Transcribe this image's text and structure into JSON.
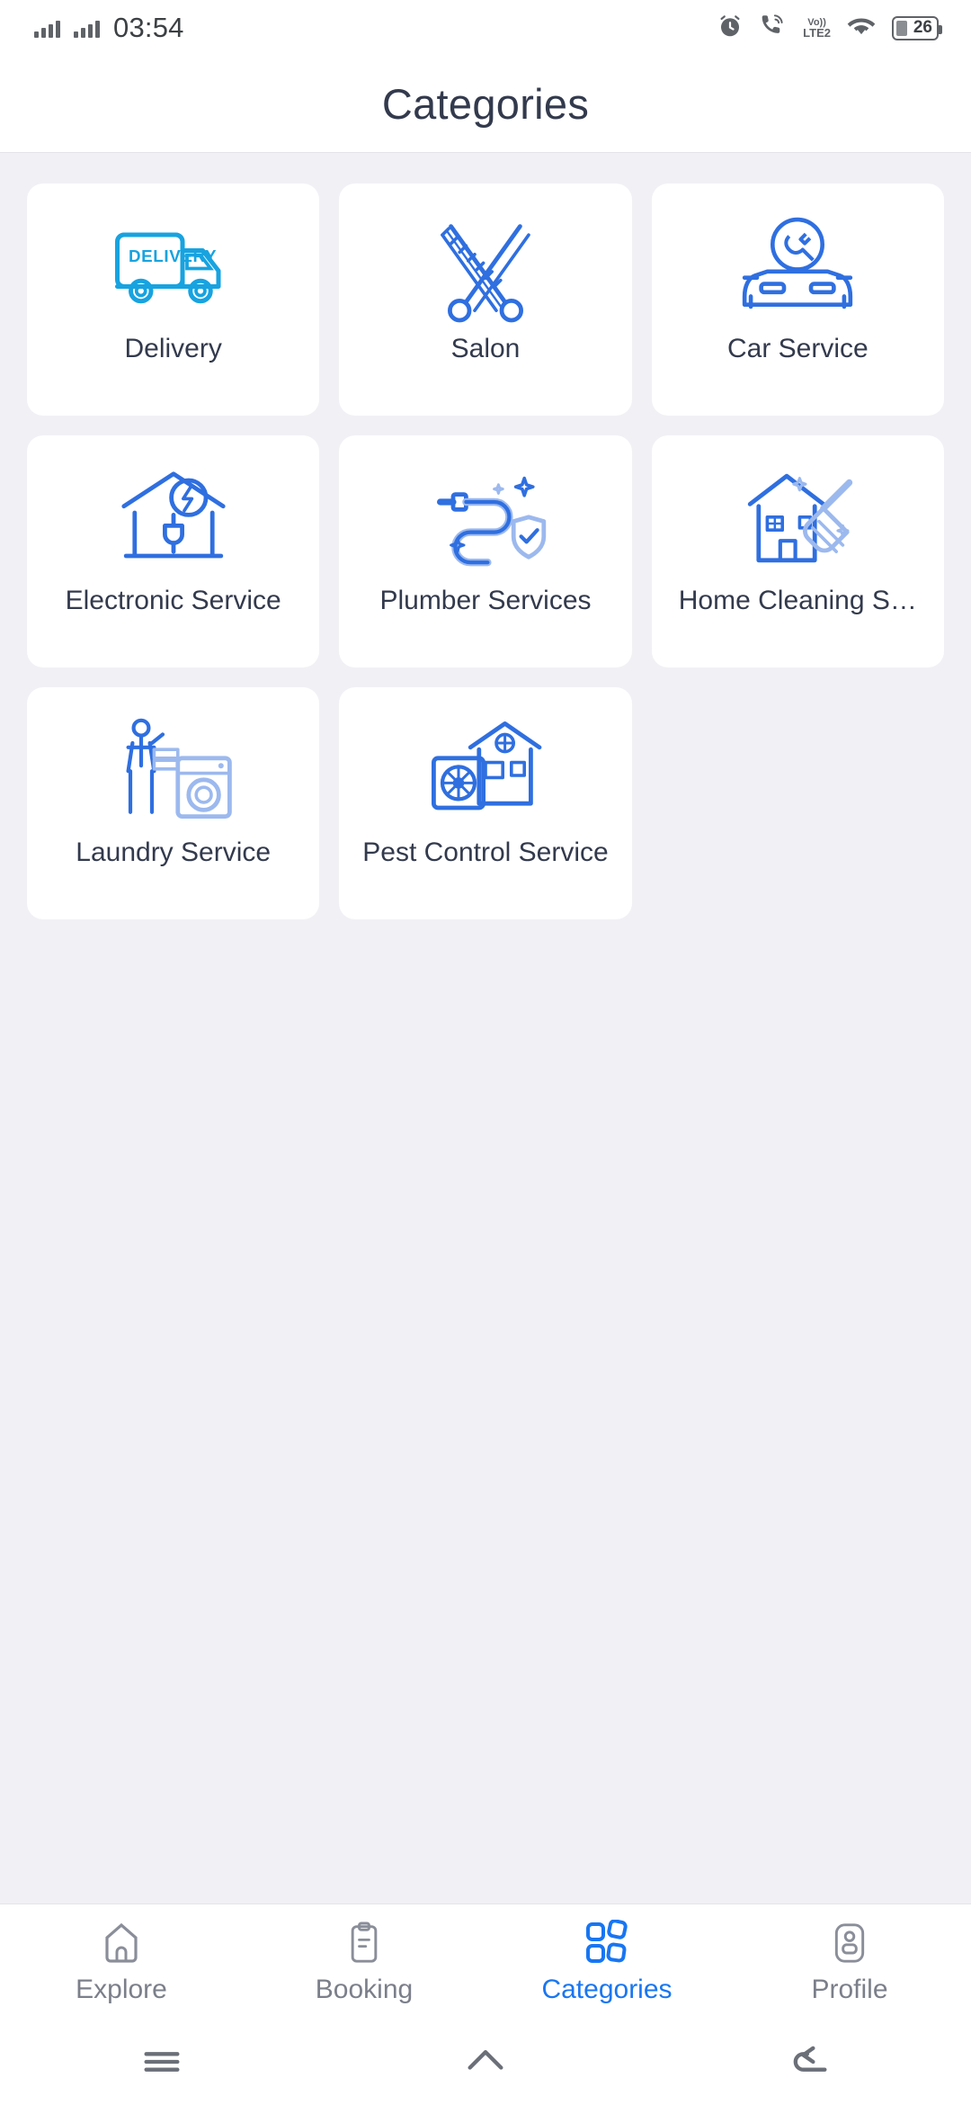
{
  "statusbar": {
    "time": "03:54",
    "battery_percent": "26",
    "network_label_top": "Vo))",
    "network_label_bottom": "LTE2",
    "icons": [
      "signal-bars-sim1",
      "signal-bars-sim2",
      "alarm-clock-icon",
      "wifi-calling-icon",
      "volte-icon",
      "wifi-icon",
      "battery-icon"
    ]
  },
  "appbar": {
    "title": "Categories"
  },
  "categories": [
    {
      "id": "delivery",
      "label": "Delivery",
      "icon": "delivery-truck-icon"
    },
    {
      "id": "salon",
      "label": "Salon",
      "icon": "scissors-comb-icon"
    },
    {
      "id": "car-service",
      "label": "Car Service",
      "icon": "car-repair-icon"
    },
    {
      "id": "electronic",
      "label": "Electronic Service",
      "icon": "electric-home-icon"
    },
    {
      "id": "plumber",
      "label": "Plumber Services",
      "icon": "pipe-wrench-icon"
    },
    {
      "id": "home-cleaning",
      "label": "Home Cleaning S…",
      "icon": "house-broom-icon"
    },
    {
      "id": "laundry",
      "label": "Laundry Service",
      "icon": "washing-machine-icon"
    },
    {
      "id": "pest-control",
      "label": "Pest Control Service",
      "icon": "pest-house-icon"
    }
  ],
  "tabbar": {
    "active": "categories",
    "items": [
      {
        "id": "explore",
        "label": "Explore",
        "icon": "home-icon"
      },
      {
        "id": "booking",
        "label": "Booking",
        "icon": "clipboard-icon"
      },
      {
        "id": "categories",
        "label": "Categories",
        "icon": "grid-blocks-icon"
      },
      {
        "id": "profile",
        "label": "Profile",
        "icon": "person-icon"
      }
    ]
  },
  "navbar": {
    "items": [
      {
        "id": "recents",
        "icon": "menu-lines-icon"
      },
      {
        "id": "home",
        "icon": "home-chevron-icon"
      },
      {
        "id": "back",
        "icon": "back-arrow-icon"
      }
    ]
  },
  "colors": {
    "accent": "#1876f2",
    "icon_blue": "#2f6fe0",
    "icon_cyan": "#17a3e0",
    "text_dark": "#333a4d",
    "bg": "#f1f1f5"
  }
}
